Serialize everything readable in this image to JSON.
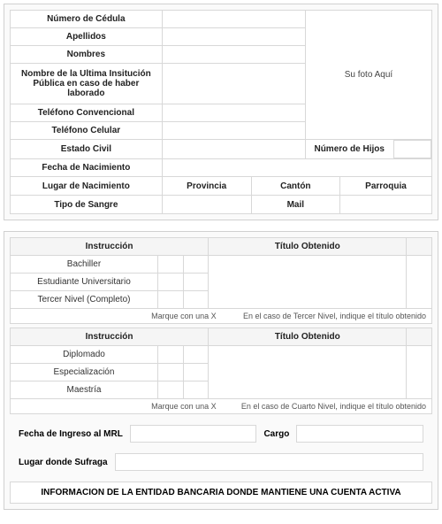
{
  "personal": {
    "cedula": "Número de Cédula",
    "apellidos": "Apellidos",
    "nombres": "Nombres",
    "ultima_inst": "Nombre de la Ultima Insitución Pública en caso de haber laborado",
    "tel_conv": "Teléfono Convencional",
    "tel_cel": "Teléfono Celular",
    "estado_civil": "Estado Civil",
    "num_hijos": "Número de Hijos",
    "fecha_nac": "Fecha de Nacimiento",
    "lugar_nac": "Lugar de Nacimiento",
    "provincia": "Provincia",
    "canton": "Cantón",
    "parroquia": "Parroquia",
    "tipo_sangre": "Tipo de Sangre",
    "mail": "Mail",
    "foto": "Su foto Aquí"
  },
  "edu1": {
    "instruccion": "Instrucción",
    "titulo": "Título Obtenido",
    "r1": "Bachiller",
    "r2": "Estudiante Universitario",
    "r3": "Tercer Nivel (Completo)",
    "note_left": "Marque con una X",
    "note_right": "En el caso de Tercer Nivel, indique el título obtenido"
  },
  "edu2": {
    "instruccion": "Instrucción",
    "titulo": "Título Obtenido",
    "r1": "Diplomado",
    "r2": "Especialización",
    "r3": "Maestría",
    "note_left": "Marque con una X",
    "note_right": "En el caso de Cuarto Nivel, indique el título obtenido"
  },
  "job": {
    "fecha_ingreso": "Fecha de Ingreso al MRL",
    "cargo": "Cargo",
    "lugar_sufraga": "Lugar donde Sufraga"
  },
  "bank": {
    "header": "INFORMACION DE LA ENTIDAD BANCARIA DONDE MANTIENE UNA CUENTA ACTIVA"
  }
}
